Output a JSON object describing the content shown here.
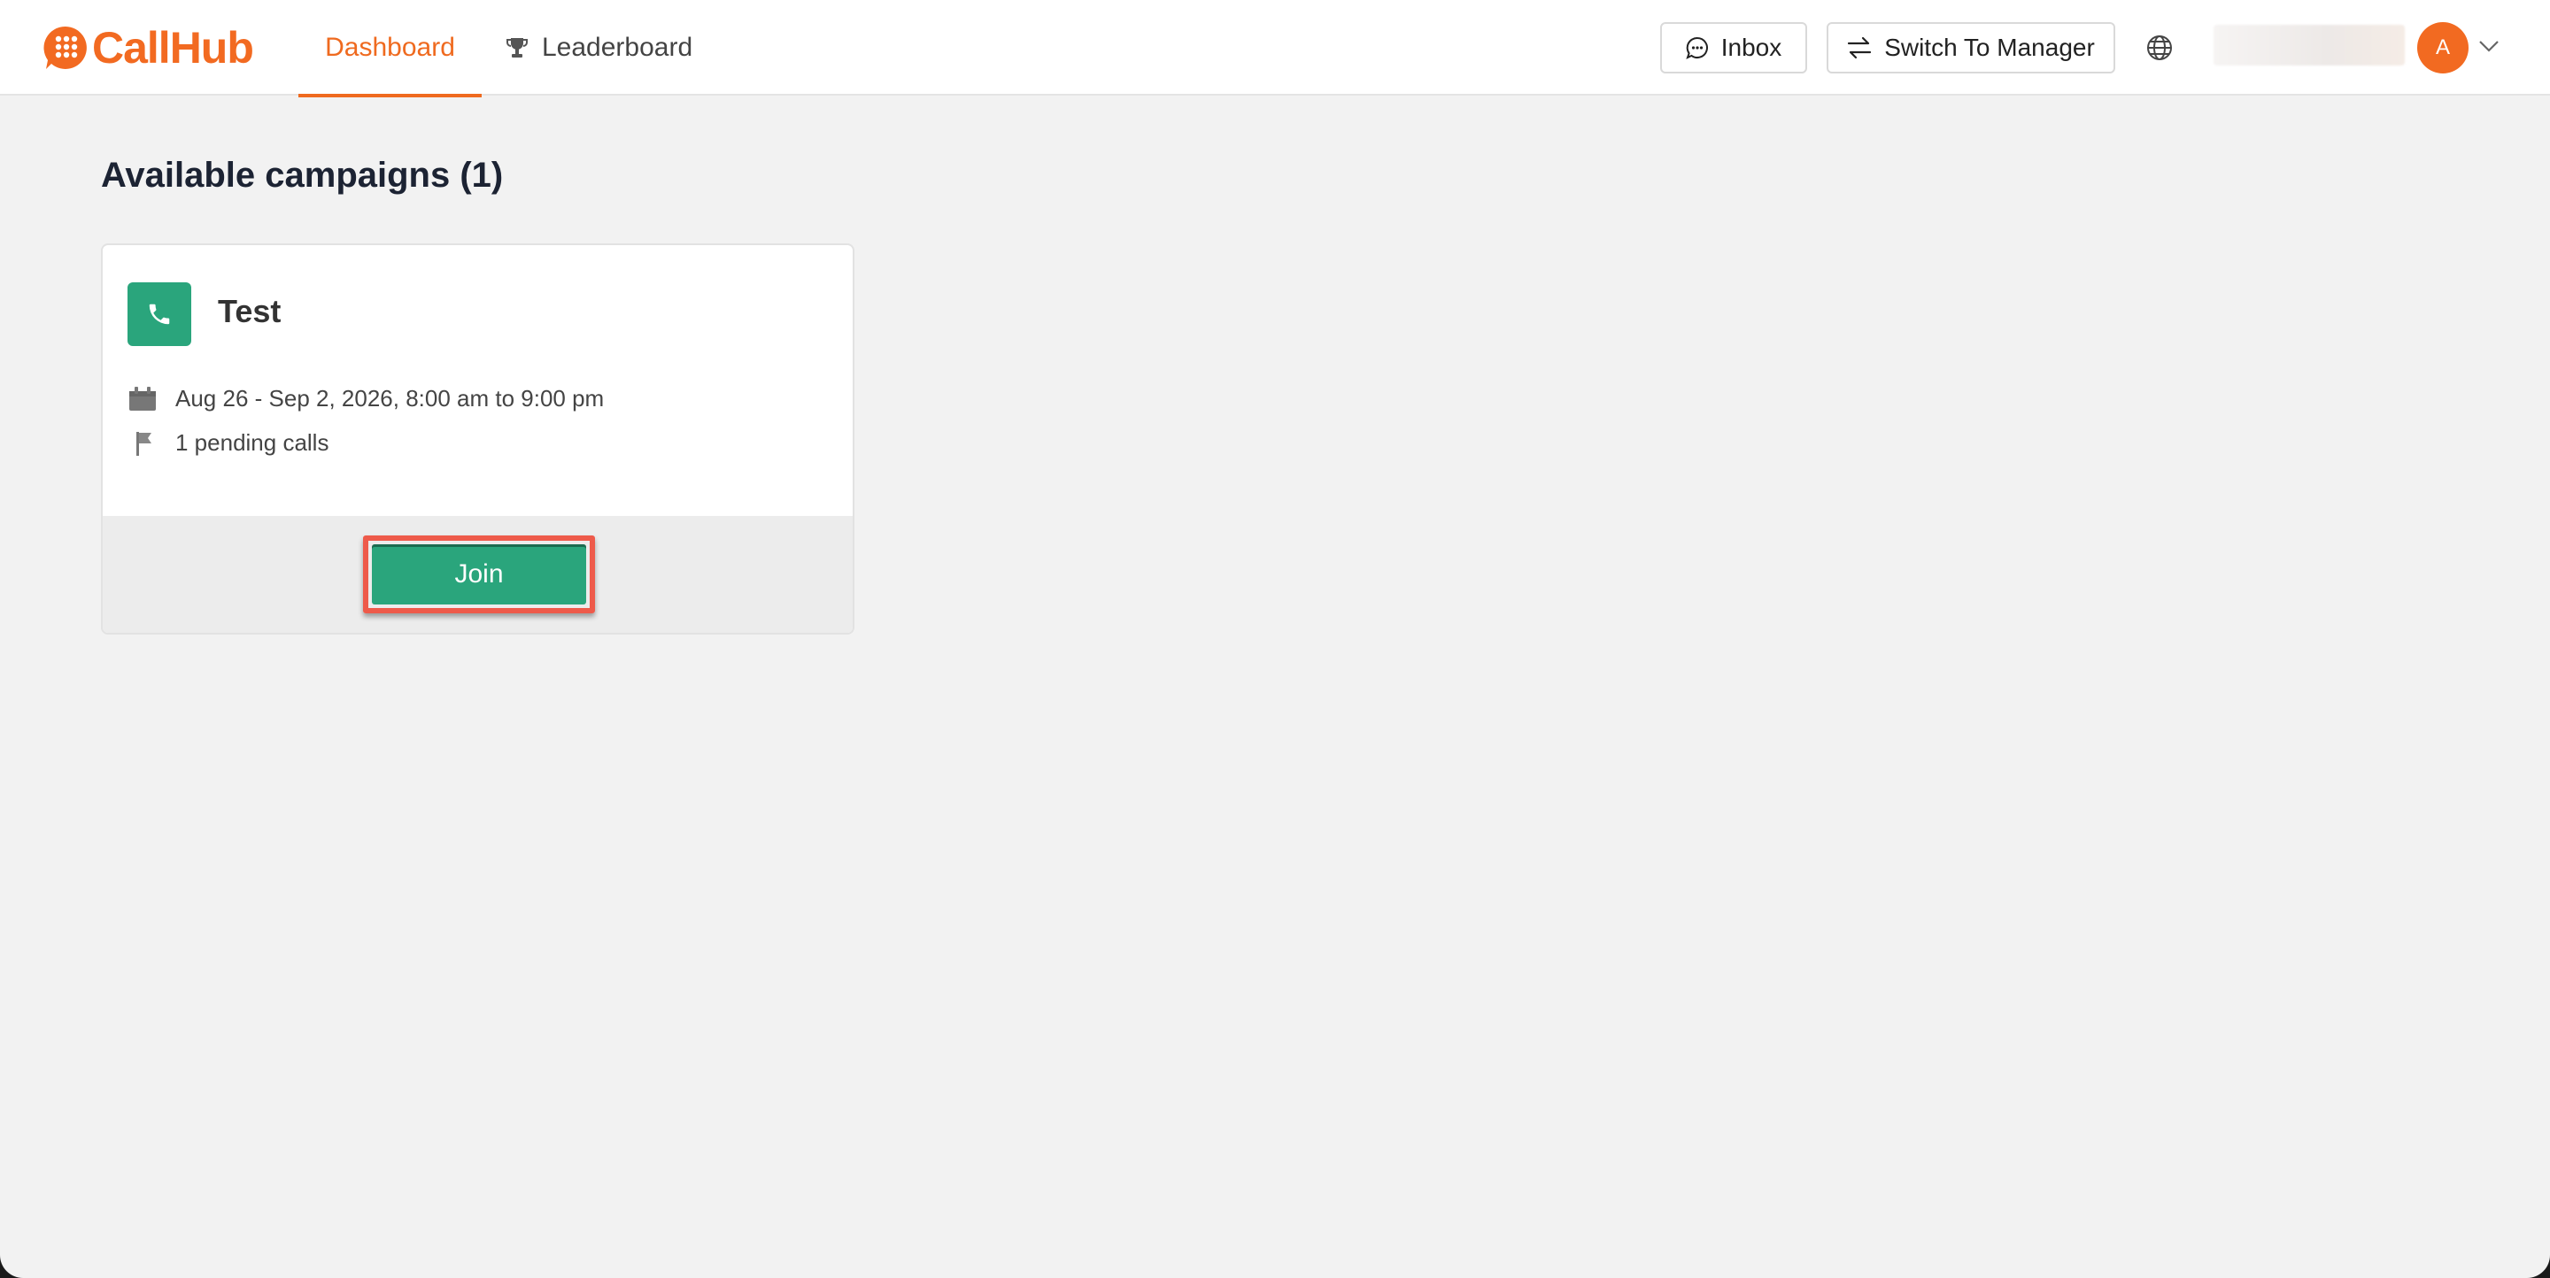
{
  "app": {
    "brand": "CallHub",
    "brand_color": "#f26a21",
    "accent_green": "#2aa57c"
  },
  "nav": {
    "tabs": [
      {
        "label": "Dashboard",
        "active": true,
        "icon": null
      },
      {
        "label": "Leaderboard",
        "active": false,
        "icon": "trophy-icon"
      }
    ]
  },
  "toolbar": {
    "inbox_label": "Inbox",
    "inbox_icon": "chat-bubble-icon",
    "switch_label": "Switch To Manager",
    "switch_icon": "swap-arrows-icon",
    "language_icon": "globe-icon"
  },
  "user": {
    "avatar_initial": "A",
    "menu_icon": "chevron-down-icon"
  },
  "main": {
    "title": "Available campaigns (1)",
    "campaigns": [
      {
        "name": "Test",
        "icon": "phone-icon",
        "schedule": "Aug 26 - Sep 2, 2026, 8:00 am to 9:00 pm",
        "schedule_icon": "calendar-icon",
        "pending": "1 pending calls",
        "pending_icon": "flag-icon",
        "action_label": "Join"
      }
    ]
  }
}
